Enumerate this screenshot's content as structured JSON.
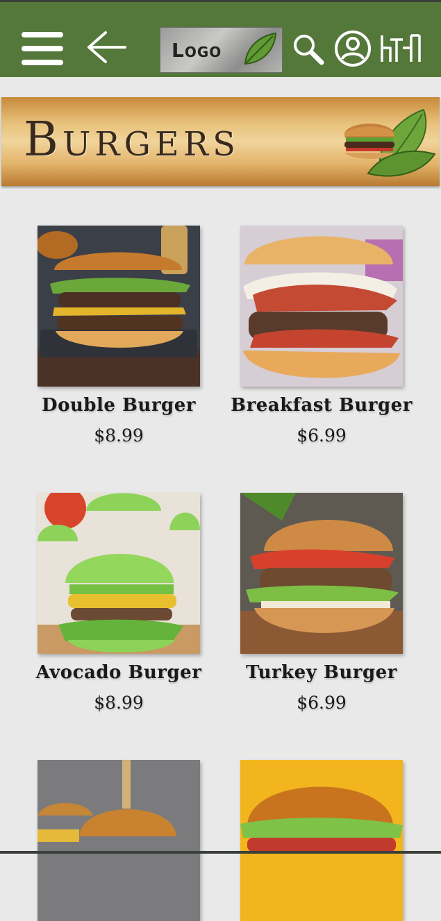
{
  "header": {
    "logo_text": "Logo",
    "icons": [
      "menu-icon",
      "back-arrow-icon",
      "search-icon",
      "user-icon",
      "cart-icon"
    ]
  },
  "banner": {
    "title": "Burgers"
  },
  "products": [
    {
      "name": "Double Burger",
      "price": "$8.99"
    },
    {
      "name": "Breakfast Burger",
      "price": "$6.99"
    },
    {
      "name": "Avocado Burger",
      "price": "$8.99"
    },
    {
      "name": "Turkey Burger",
      "price": "$6.99"
    }
  ],
  "colors": {
    "header": "#54773a",
    "background": "#e9e9e9",
    "banner": "#e3b46b",
    "text": "#1a1a1a"
  }
}
